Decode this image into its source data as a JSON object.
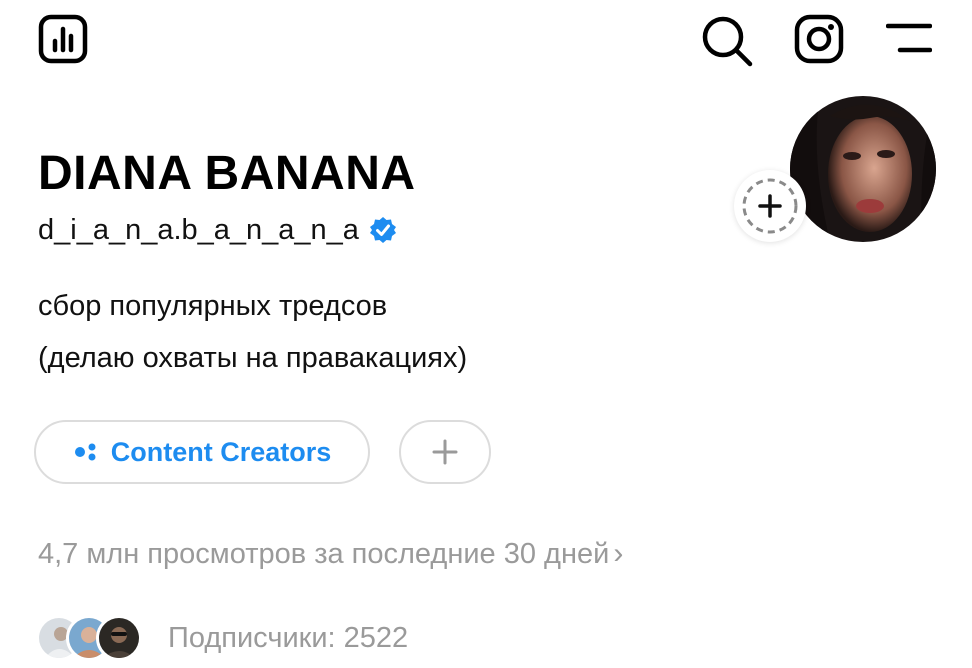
{
  "header": {
    "icons": [
      "insights-icon",
      "search-icon",
      "instagram-icon",
      "menu-icon"
    ]
  },
  "profile": {
    "display_name": "DIANA BANANA",
    "username": "d_i_a_n_a.b_a_n_a_n_a",
    "verified": true,
    "bio_lines": [
      "сбор популярных тредсов",
      "(делаю охваты на правакациях)"
    ]
  },
  "chips": {
    "community_label": "Content Creators",
    "add_label": "+"
  },
  "stats": {
    "views_text": "4,7 млн просмотров за последние 30 дней",
    "views_chevron": "›",
    "followers_text": "Подписчики: 2522"
  },
  "colors": {
    "accent": "#1d8cf0",
    "muted_text": "#9a9a9a",
    "chip_border": "#dcdcdc"
  }
}
